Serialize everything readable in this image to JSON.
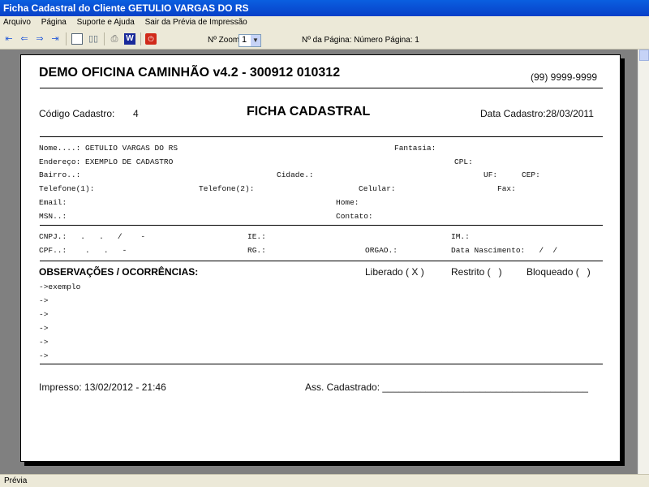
{
  "window": {
    "title": "Ficha Cadastral do Cliente GETULIO VARGAS DO RS"
  },
  "menu": [
    "Arquivo",
    "Página",
    "Suporte e Ajuda",
    "Sair da Prévia de Impressão"
  ],
  "toolbar": {
    "zoom_label": "Nº Zoom",
    "zoom_value": "1",
    "page_label": "Nº da Página: Número Página: 1"
  },
  "report": {
    "company": "DEMO OFICINA CAMINHÃO v4.2 - 300912 010312",
    "phone": "(99) 9999-9999",
    "code_label": "Código Cadastro:",
    "code_value": "4",
    "title": "FICHA CADASTRAL",
    "date_label": "Data Cadastro:28/03/2011",
    "fields": {
      "nome": "Nome....: GETULIO VARGAS DO RS",
      "fantasia": "Fantasia:",
      "endereco": "Endereço: EXEMPLO DE CADASTRO",
      "cpl": "CPL:",
      "bairro": "Bairro..:",
      "cidade": "Cidade.:",
      "uf": "UF:",
      "cep": "CEP:",
      "tel1": "Telefone(1):",
      "tel2": "Telefone(2):",
      "celular": "Celular:",
      "fax": "Fax:",
      "email": "Email:",
      "home": "Home:",
      "msn": "MSN..:",
      "contato": "Contato:",
      "cnpj": "CNPJ.:   .   .   /    -",
      "ie": "IE.:",
      "im": "IM.:",
      "cpf": "CPF..:    .   .   -",
      "rg": "RG.:",
      "orgao": "ORGAO.:",
      "nascimento": "Data Nascimento:   /  /"
    },
    "obs_title": "OBSERVAÇÕES / OCORRÊNCIAS:",
    "liberado": "Liberado ( X )",
    "restrito": "Restrito (   )",
    "bloqueado": "Bloqueado (   )",
    "obs_lines": [
      "->exemplo",
      "->",
      "->",
      "->",
      "->",
      "->"
    ],
    "printed": "Impresso: 13/02/2012 - 21:46",
    "signature": "Ass. Cadastrado: ______________________________________"
  },
  "status": "Prévia"
}
